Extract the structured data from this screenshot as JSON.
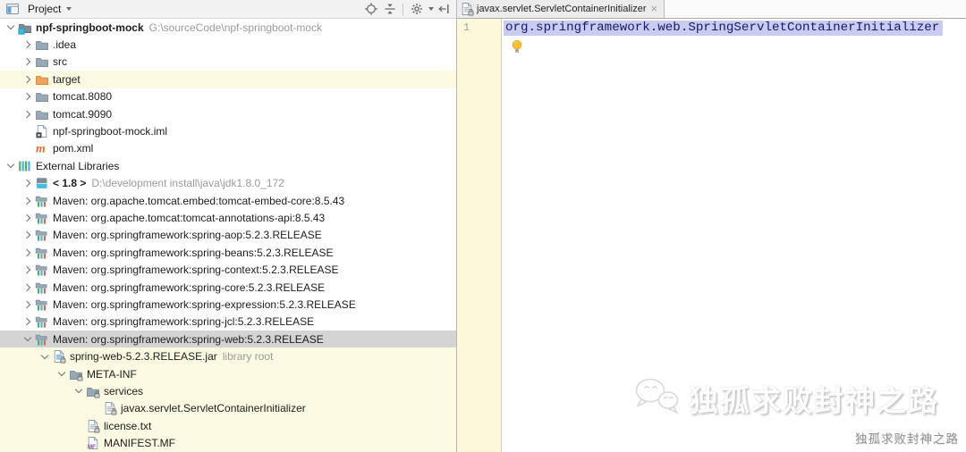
{
  "project_panel": {
    "title": "Project",
    "toolbar": {
      "icons": [
        "locate",
        "collapse-all",
        "settings",
        "hide-panel"
      ]
    },
    "tree": {
      "rows": [
        {
          "indent": 0,
          "chevron": "down",
          "icon": "project-folder",
          "label": "npf-springboot-mock",
          "bold": true,
          "suffix": "G:\\sourceCode\\npf-springboot-mock"
        },
        {
          "indent": 1,
          "chevron": "right",
          "icon": "folder",
          "label": ".idea"
        },
        {
          "indent": 1,
          "chevron": "right",
          "icon": "folder",
          "label": "src"
        },
        {
          "indent": 1,
          "chevron": "right",
          "icon": "folder-excluded",
          "label": "target",
          "bg": "yellow"
        },
        {
          "indent": 1,
          "chevron": "right",
          "icon": "folder",
          "label": "tomcat.8080"
        },
        {
          "indent": 1,
          "chevron": "right",
          "icon": "folder",
          "label": "tomcat.9090"
        },
        {
          "indent": 1,
          "chevron": null,
          "icon": "module-file",
          "label": "npf-springboot-mock.iml"
        },
        {
          "indent": 1,
          "chevron": null,
          "icon": "maven",
          "label": "pom.xml"
        },
        {
          "indent": 0,
          "chevron": "down",
          "icon": "external-libraries",
          "label": "External Libraries"
        },
        {
          "indent": 1,
          "chevron": "right",
          "icon": "jdk",
          "label": "< 1.8 >",
          "bold": true,
          "suffix": "D:\\development install\\java\\jdk1.8.0_172"
        },
        {
          "indent": 1,
          "chevron": "right",
          "icon": "library",
          "label": "Maven: org.apache.tomcat.embed:tomcat-embed-core:8.5.43"
        },
        {
          "indent": 1,
          "chevron": "right",
          "icon": "library",
          "label": "Maven: org.apache.tomcat:tomcat-annotations-api:8.5.43"
        },
        {
          "indent": 1,
          "chevron": "right",
          "icon": "library",
          "label": "Maven: org.springframework:spring-aop:5.2.3.RELEASE"
        },
        {
          "indent": 1,
          "chevron": "right",
          "icon": "library",
          "label": "Maven: org.springframework:spring-beans:5.2.3.RELEASE"
        },
        {
          "indent": 1,
          "chevron": "right",
          "icon": "library",
          "label": "Maven: org.springframework:spring-context:5.2.3.RELEASE"
        },
        {
          "indent": 1,
          "chevron": "right",
          "icon": "library",
          "label": "Maven: org.springframework:spring-core:5.2.3.RELEASE"
        },
        {
          "indent": 1,
          "chevron": "right",
          "icon": "library",
          "label": "Maven: org.springframework:spring-expression:5.2.3.RELEASE"
        },
        {
          "indent": 1,
          "chevron": "right",
          "icon": "library",
          "label": "Maven: org.springframework:spring-jcl:5.2.3.RELEASE"
        },
        {
          "indent": 1,
          "chevron": "down",
          "icon": "library",
          "label": "Maven: org.springframework:spring-web:5.2.3.RELEASE",
          "bg": "selected"
        },
        {
          "indent": 2,
          "chevron": "down",
          "icon": "jar",
          "label": "spring-web-5.2.3.RELEASE.jar",
          "suffix": "library root",
          "bg": "yellow"
        },
        {
          "indent": 3,
          "chevron": "down",
          "icon": "folder-locked",
          "label": "META-INF",
          "bg": "yellow"
        },
        {
          "indent": 4,
          "chevron": "down",
          "icon": "folder-locked",
          "label": "services",
          "bg": "yellow"
        },
        {
          "indent": 5,
          "chevron": null,
          "icon": "file-locked",
          "label": "javax.servlet.ServletContainerInitializer",
          "bg": "yellow"
        },
        {
          "indent": 4,
          "chevron": null,
          "icon": "text-file-locked",
          "label": "license.txt",
          "bg": "yellow"
        },
        {
          "indent": 4,
          "chevron": null,
          "icon": "manifest-file",
          "label": "MANIFEST.MF",
          "bg": "yellow"
        }
      ]
    }
  },
  "editor": {
    "tab": {
      "label": "javax.servlet.ServletContainerInitializer",
      "close_label": "×",
      "icon": "file-locked"
    },
    "gutter": {
      "line_number": "1"
    },
    "code": {
      "line1": "org.springframework.web.SpringServletContainerInitializer"
    },
    "bulb_icon": "intention-bulb"
  },
  "watermark": {
    "logo": "wechat-logo",
    "title": "独孤求败封神之路",
    "subtitle": "独孤求败封神之路"
  },
  "colors": {
    "tree_highlight_yellow": "#fafbe2",
    "tree_selected_gray": "#d4d4d4",
    "editor_selection": "#cacbf1",
    "editor_gutter": "#fcf8d9",
    "excluded_folder_orange": "#eba45e",
    "maven_orange": "#df6f3b",
    "code_text": "#17176b"
  }
}
